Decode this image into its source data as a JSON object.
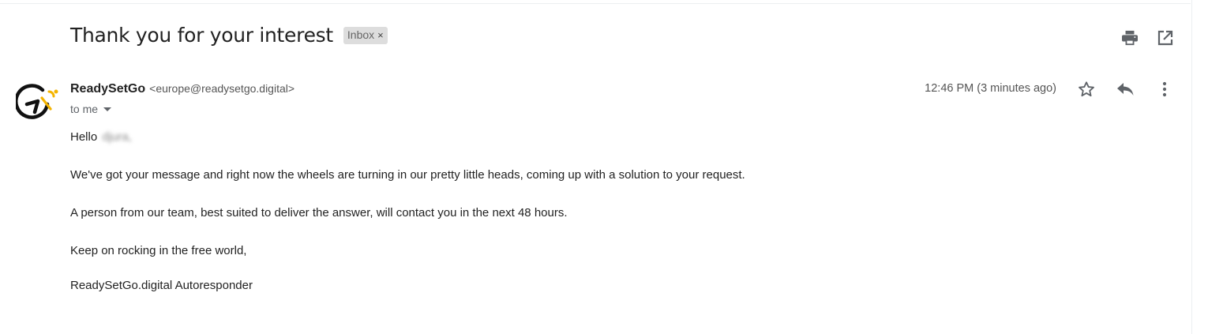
{
  "message": {
    "subject": "Thank you for your interest",
    "label": "Inbox",
    "label_close": "×",
    "sender": {
      "name": "ReadySetGo",
      "email": "<europe@readysetgo.digital>"
    },
    "recipient_line": "to me",
    "timestamp": "12:46 PM (3 minutes ago)",
    "body": {
      "greeting": "Hello",
      "greeting_name": "djura,",
      "paragraph_1": "We've got your message and right now the wheels are turning in our pretty little heads, coming up with a solution to your request.",
      "paragraph_2": "A person from our team, best suited to deliver the answer, will contact you in the next 48 hours.",
      "paragraph_3": "Keep on rocking in the free world,",
      "signature": "ReadySetGo.digital Autoresponder"
    }
  },
  "icons": {
    "print": "print-icon",
    "open_new_window": "open-in-new-window-icon",
    "star": "star-icon",
    "reply": "reply-icon",
    "more": "more-vertical-icon",
    "avatar_logo": "readysetgo-logo"
  },
  "colors": {
    "icon_gray": "#5f6368",
    "label_chip_bg": "#dddddd",
    "logo_black": "#111111",
    "logo_yellow": "#f4b400"
  }
}
